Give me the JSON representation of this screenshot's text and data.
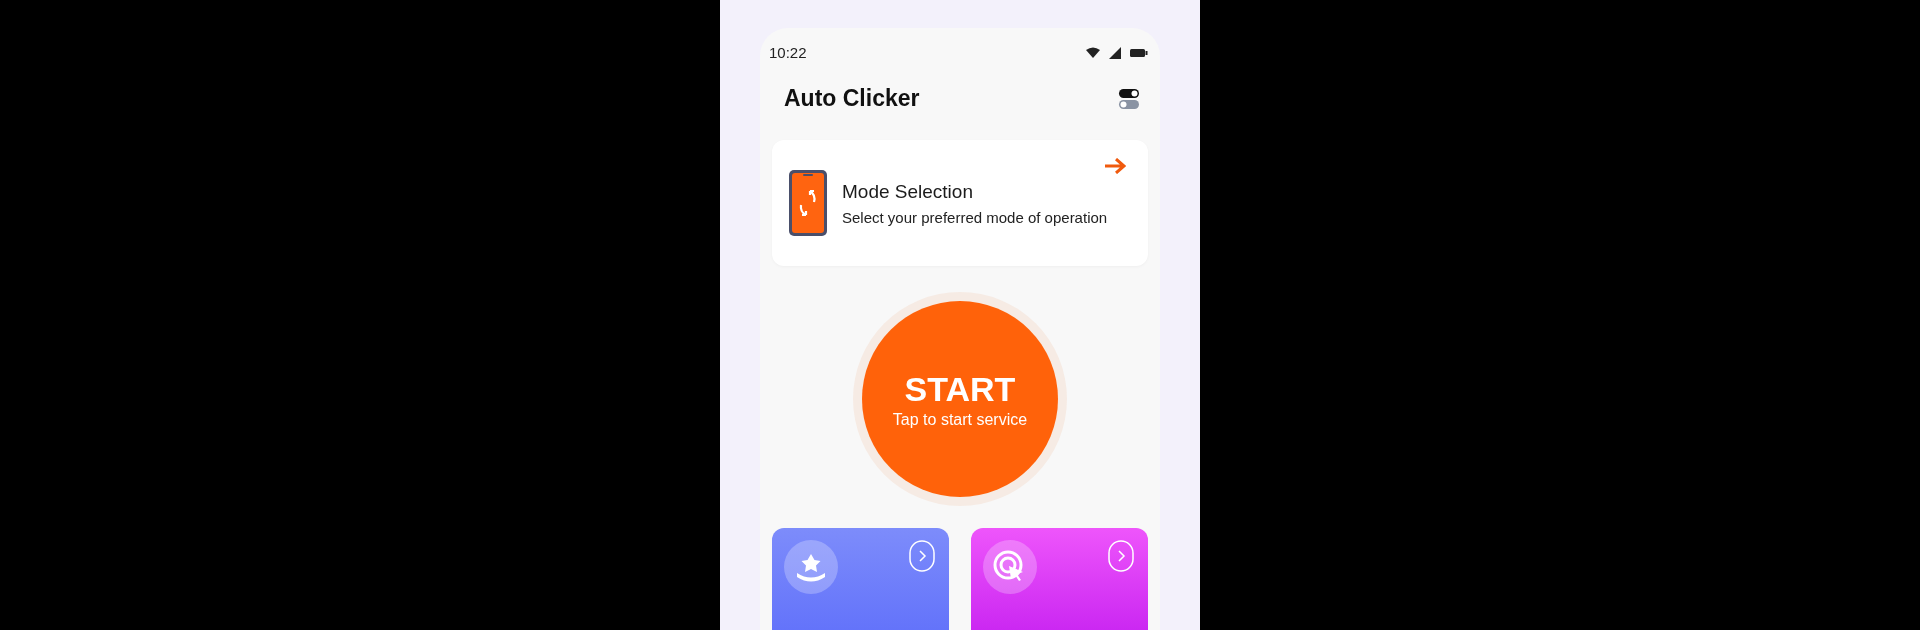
{
  "status_bar": {
    "time": "10:22"
  },
  "app_bar": {
    "title": "Auto Clicker"
  },
  "mode_card": {
    "title": "Mode Selection",
    "subtitle": "Select your preferred mode of operation"
  },
  "start_button": {
    "label": "START",
    "caption": "Tap to start service"
  },
  "feature_cards": [
    {
      "kind": "star",
      "color": "#6f7dfb"
    },
    {
      "kind": "target",
      "color": "#d63cf5"
    }
  ]
}
